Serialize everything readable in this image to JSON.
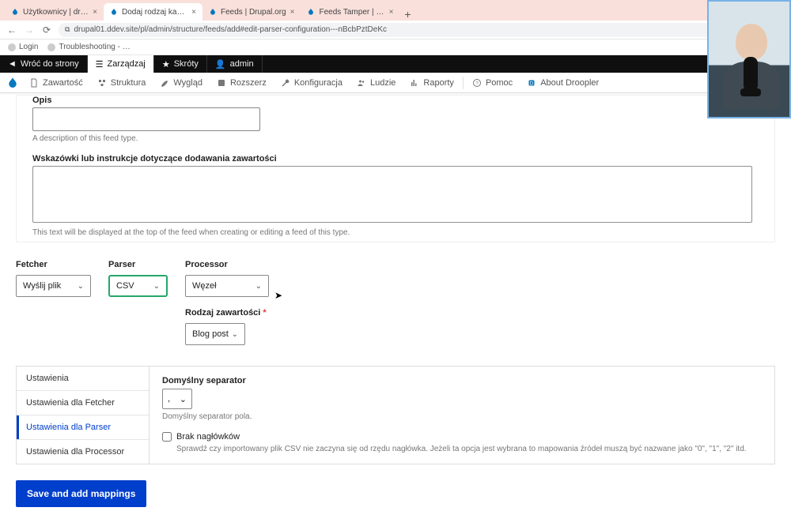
{
  "browser": {
    "tabs": [
      {
        "title": "Użytkownicy | droopler"
      },
      {
        "title": "Dodaj rodzaj kanału | droopl…"
      },
      {
        "title": "Feeds | Drupal.org"
      },
      {
        "title": "Feeds Tamper | Drupal.org"
      }
    ],
    "url": "drupal01.ddev.site/pl/admin/structure/feeds/add#edit-parser-configuration---nBcbPztDeKc",
    "bookmarks": {
      "login": "Login",
      "trouble": "Troubleshooting - …"
    }
  },
  "adminbar": {
    "back": "Wróć do strony",
    "manage": "Zarządzaj",
    "shortcuts": "Skróty",
    "user": "admin"
  },
  "toolbar": {
    "content": "Zawartość",
    "structure": "Struktura",
    "appearance": "Wygląd",
    "extend": "Rozszerz",
    "config": "Konfiguracja",
    "people": "Ludzie",
    "reports": "Raporty",
    "help": "Pomoc",
    "about": "About Droopler"
  },
  "form": {
    "opis_label": "Opis",
    "opis_desc": "A description of this feed type.",
    "hints_label": "Wskazówki lub instrukcje dotyczące dodawania zawartości",
    "hints_desc": "This text will be displayed at the top of the feed when creating or editing a feed of this type."
  },
  "selects": {
    "fetcher_label": "Fetcher",
    "fetcher_value": "Wyślij plik",
    "parser_label": "Parser",
    "parser_value": "CSV",
    "processor_label": "Processor",
    "processor_value": "Węzeł",
    "content_type_label": "Rodzaj zawartości",
    "content_type_value": "Blog post"
  },
  "vtabs": {
    "t1": "Ustawienia",
    "t2": "Ustawienia dla Fetcher",
    "t3": "Ustawienia dla Parser",
    "t4": "Ustawienia dla Processor"
  },
  "pane": {
    "sep_label": "Domyślny separator",
    "sep_value": ",",
    "sep_desc": "Domyślny separator pola.",
    "noheaders_label": "Brak nagłówków",
    "noheaders_desc": "Sprawdź czy importowany plik CSV nie zaczyna się od rzędu nagłówka. Jeżeli ta opcja jest wybrana to mapowania źródeł muszą być nazwane jako \"0\", \"1\", \"2\" itd."
  },
  "buttons": {
    "save": "Save and add mappings"
  }
}
